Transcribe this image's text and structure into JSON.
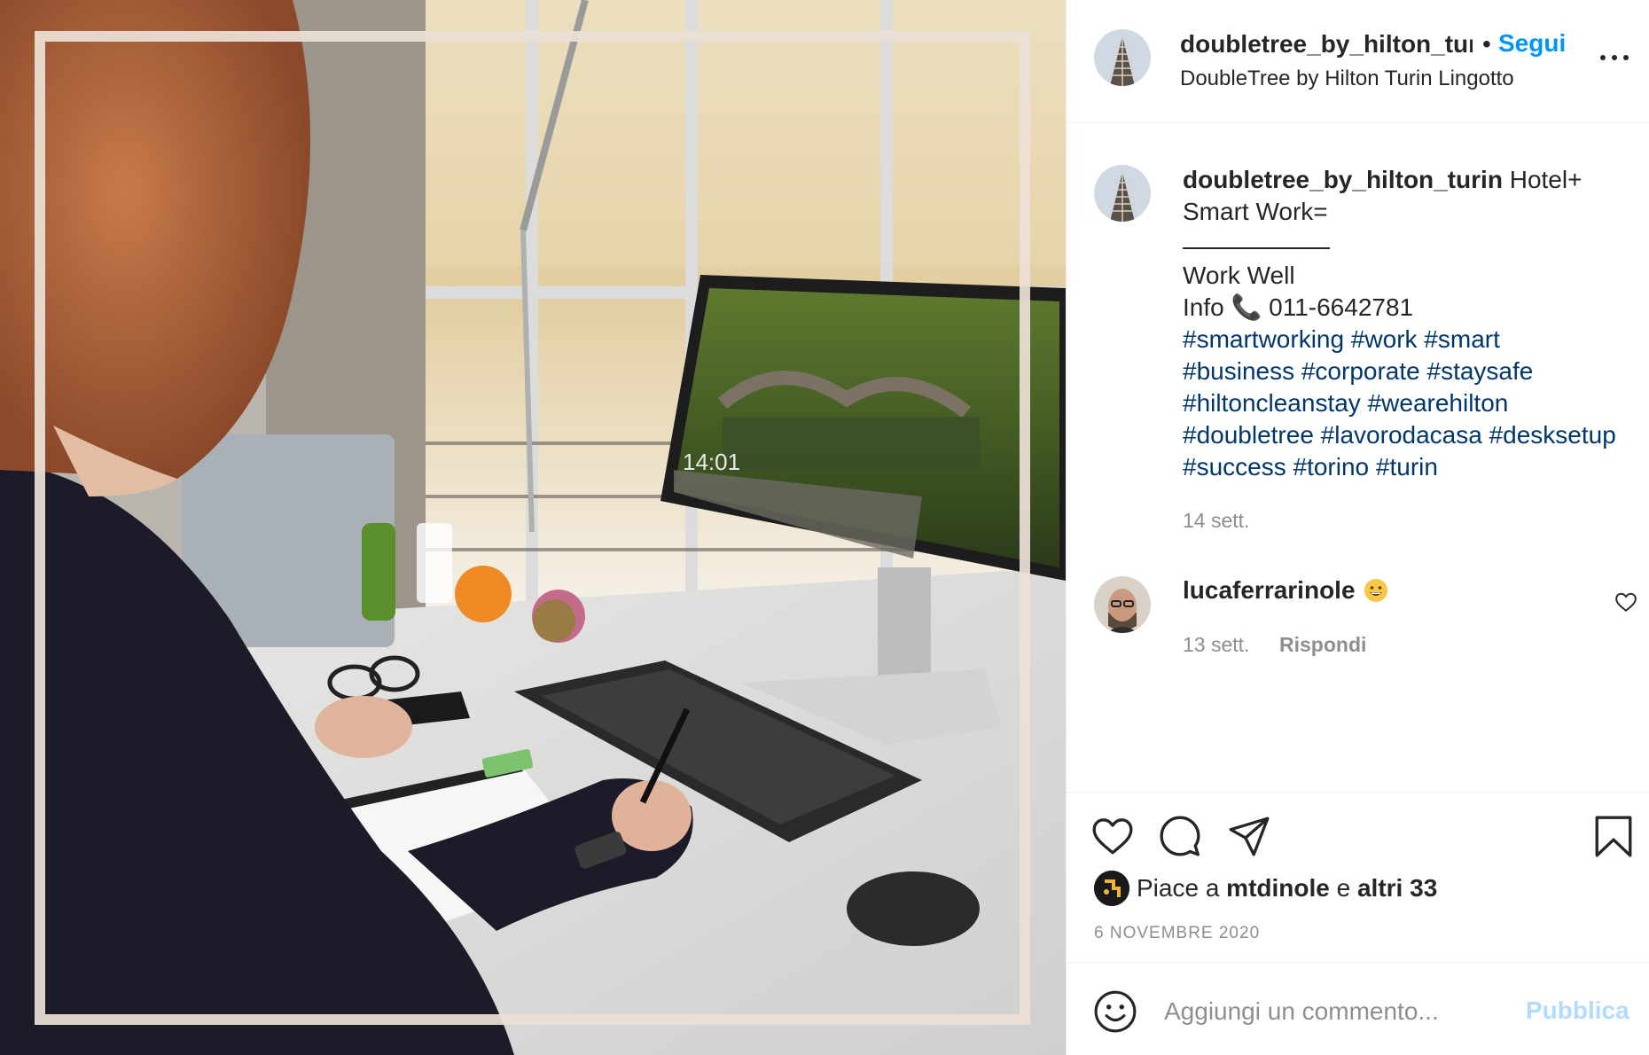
{
  "post": {
    "photo_alt": "Donna alla scrivania con monitor e tastiera",
    "username": "doubletree_by_hilton_turin",
    "header_username": "doubletree_by_hilton_turi",
    "separator": "•",
    "follow_label": "Segui",
    "location": "DoubleTree by Hilton Turin Lingotto",
    "caption": {
      "text_line1": " Hotel+",
      "text_line2": "Smart Work=",
      "line3": "Work Well",
      "info_label": "Info ",
      "phone_icon": "📞",
      "phone": " 011-6642781",
      "hashtag_lines": [
        "#smartworking #work #smart",
        "#business #corporate #staysafe",
        "#hiltoncleanstay #wearehilton",
        "#doubletree #lavorodacasa #desksetup",
        "#success #torino #turin"
      ],
      "time": "14 sett."
    },
    "comments": [
      {
        "username": "lucaferrarinole",
        "emoji": "grinning-face-emoji",
        "time": "13 sett.",
        "reply_label": "Rispondi"
      }
    ],
    "likes": {
      "prefix": "Piace a ",
      "user": "mtdinole",
      "middle": " e ",
      "others": "altri 33"
    },
    "date": "6 NOVEMBRE 2020",
    "add_comment": {
      "placeholder": "Aggiungi un commento...",
      "publish_label": "Pubblica"
    }
  },
  "colors": {
    "link_blue": "#0095f6",
    "hashtag": "#00376b",
    "muted": "#8e8e8e",
    "publish_disabled": "#b3dbff",
    "frame": "#ece0d6"
  },
  "icons": {
    "more": "more-options-icon",
    "like": "heart-icon",
    "comment": "comment-bubble-icon",
    "share": "paper-plane-icon",
    "save": "bookmark-icon",
    "emoji": "smiley-icon"
  }
}
